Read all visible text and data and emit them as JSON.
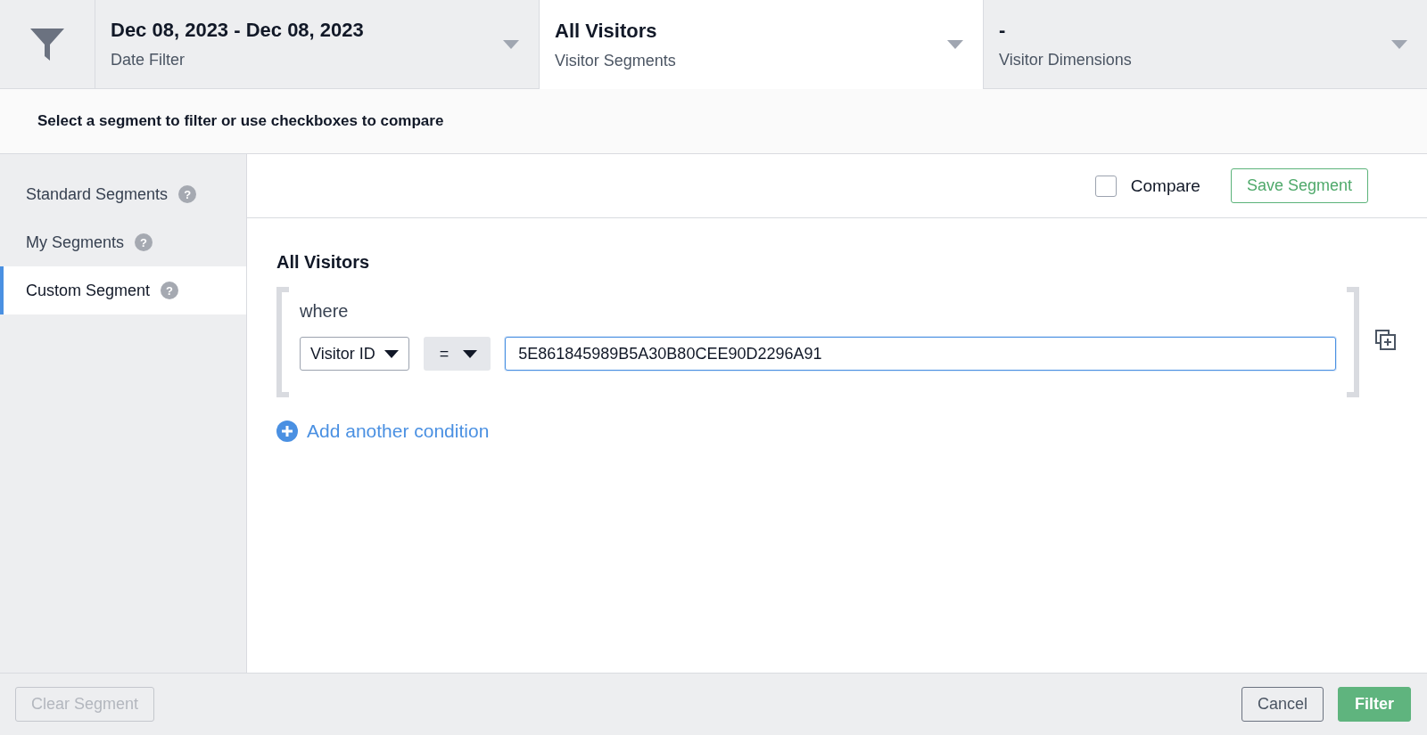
{
  "filter_tabs": [
    {
      "value": "Dec 08, 2023 - Dec 08, 2023",
      "label": "Date Filter",
      "selected": false
    },
    {
      "value": "All Visitors",
      "label": "Visitor Segments",
      "selected": true
    },
    {
      "value": "-",
      "label": "Visitor Dimensions",
      "selected": false
    }
  ],
  "hint": "Select a segment to filter or use checkboxes to compare",
  "sidebar": {
    "items": [
      {
        "label": "Standard Segments",
        "help": "?",
        "selected": false
      },
      {
        "label": "My Segments",
        "help": "?",
        "selected": false
      },
      {
        "label": "Custom Segment",
        "help": "?",
        "selected": true
      }
    ]
  },
  "compare": {
    "label": "Compare",
    "checked": false
  },
  "save_button": "Save Segment",
  "segment": {
    "title": "All Visitors",
    "where": "where",
    "conditions": [
      {
        "field": "Visitor ID",
        "operator": "=",
        "value": "5E861845989B5A30B80CEE90D2296A91"
      }
    ],
    "add_condition": "Add another condition"
  },
  "footer": {
    "clear_button": {
      "label": "Clear Segment",
      "disabled": true
    },
    "cancel_button": "Cancel",
    "filter_button": "Filter"
  }
}
